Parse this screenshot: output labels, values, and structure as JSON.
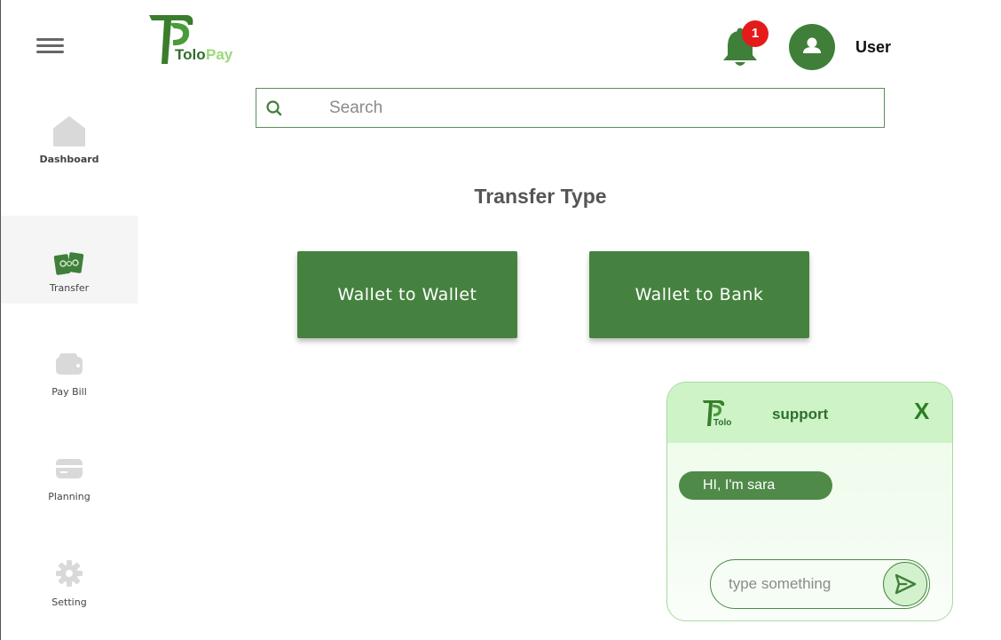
{
  "app": {
    "logo_text": "ToloPay",
    "logo_part1": "Tolo",
    "logo_part2": "Pay"
  },
  "sidebar": {
    "items": [
      {
        "label": "Dashboard",
        "icon": "home-icon"
      },
      {
        "label": "Transfer",
        "icon": "money-icon",
        "active": true
      },
      {
        "label": "Pay Bill",
        "icon": "wallet-icon"
      },
      {
        "label": "Planning",
        "icon": "card-icon"
      },
      {
        "label": "Setting",
        "icon": "gear-icon"
      }
    ]
  },
  "header": {
    "notification_count": "1",
    "user_name": "User"
  },
  "search": {
    "placeholder": "Search",
    "value": ""
  },
  "main": {
    "title": "Transfer Type",
    "buttons": [
      "Wallet to Wallet",
      "Wallet to Bank"
    ]
  },
  "chat": {
    "logo_text": "Tolo",
    "title": "support",
    "close_label": "X",
    "messages": [
      "HI, I'm sara"
    ],
    "input_placeholder": "type something",
    "input_value": ""
  },
  "colors": {
    "primary": "#45823f",
    "logo_dark": "#3a7d2c",
    "logo_light": "#9ad87a",
    "badge": "#e41b1b",
    "chat_header": "#cdf3c6",
    "sidebar_active_bg": "#f5f5f5",
    "icon_gray": "#d9d9d9"
  }
}
